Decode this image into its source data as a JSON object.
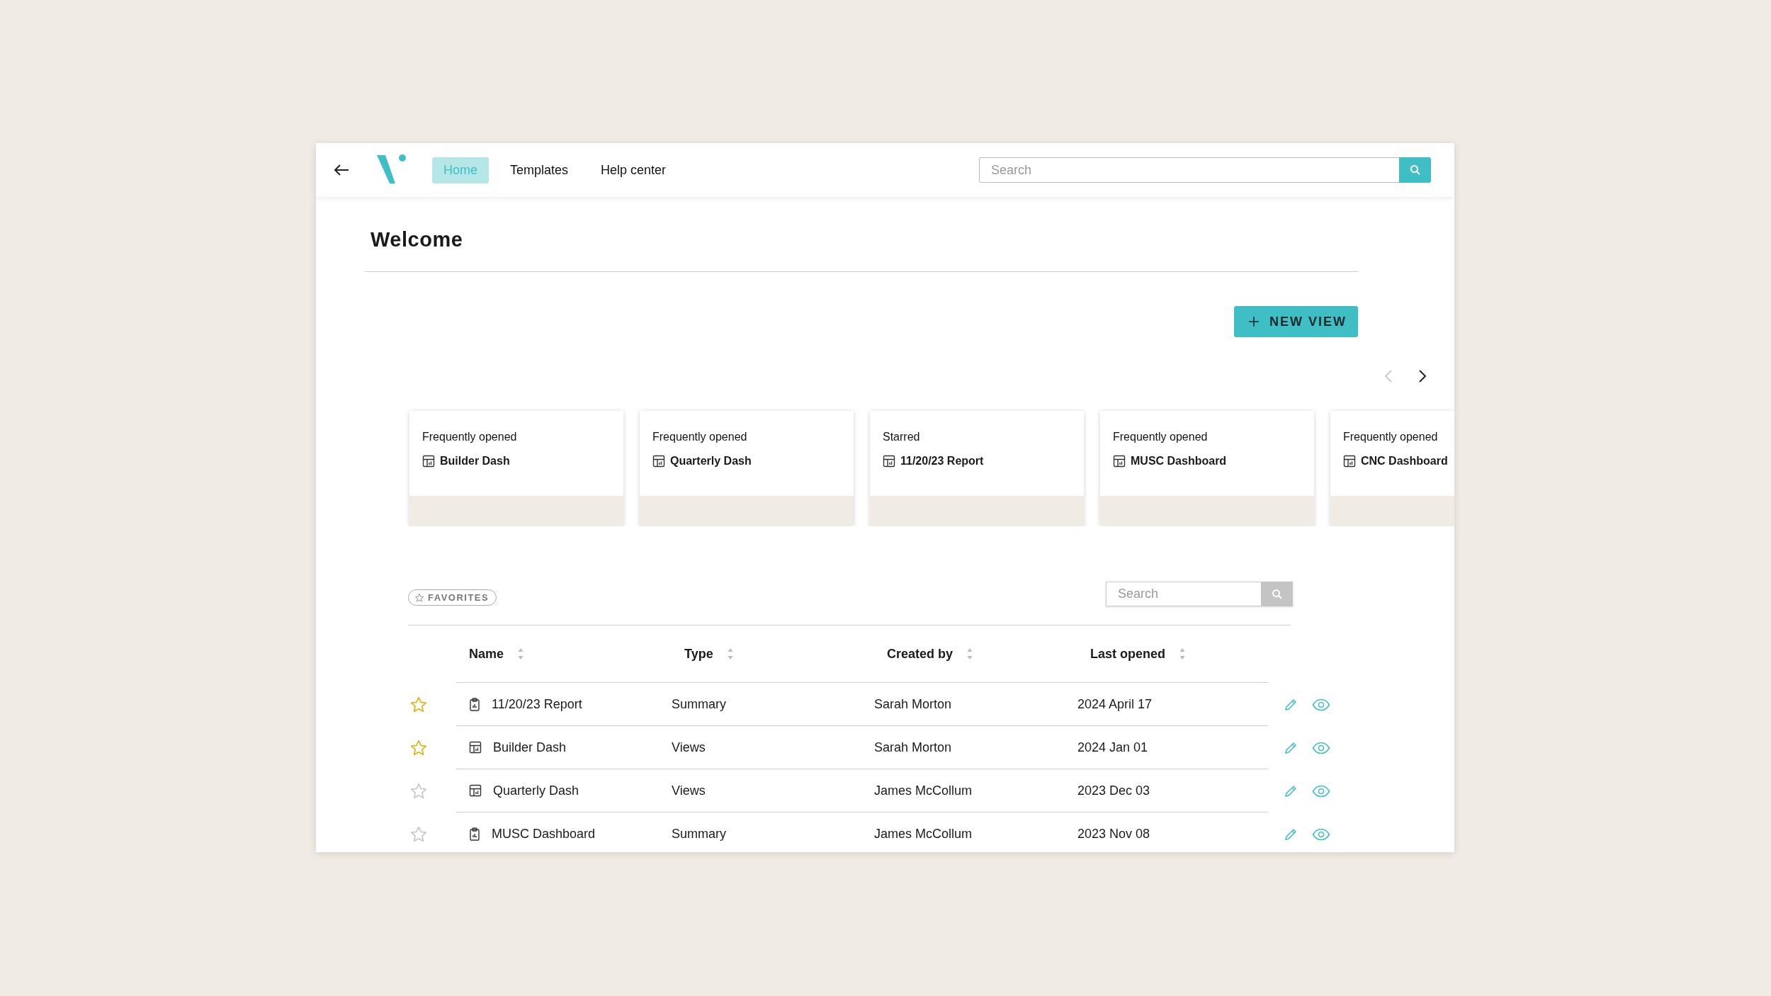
{
  "header": {
    "tabs": [
      {
        "label": "Home",
        "selected": true
      },
      {
        "label": "Templates",
        "selected": false
      },
      {
        "label": "Help center",
        "selected": false
      }
    ],
    "search": {
      "placeholder": "Search"
    }
  },
  "welcome": {
    "title": "Welcome",
    "new_view_button": "NEW VIEW"
  },
  "carousel": {
    "prev_disabled": true,
    "next_disabled": false
  },
  "cards": [
    {
      "caption": "Frequently opened",
      "name": "Builder Dash"
    },
    {
      "caption": "Frequently opened",
      "name": "Quarterly Dash"
    },
    {
      "caption": "Starred",
      "name": "11/20/23 Report"
    },
    {
      "caption": "Frequently opened",
      "name": "MUSC Dashboard"
    },
    {
      "caption": "Frequently opened",
      "name": "CNC Dashboard"
    }
  ],
  "favorites": {
    "filter_label": "FAVORITES",
    "search": {
      "placeholder": "Search"
    }
  },
  "table": {
    "columns": [
      "Name",
      "Type",
      "Created by",
      "Last opened"
    ],
    "rows": [
      {
        "starred": true,
        "kind": "report",
        "name": "11/20/23 Report",
        "type": "Summary",
        "created_by": "Sarah Morton",
        "last_opened": "2024 April 17"
      },
      {
        "starred": true,
        "kind": "dashboard",
        "name": "Builder Dash",
        "type": "Views",
        "created_by": "Sarah Morton",
        "last_opened": "2024 Jan 01"
      },
      {
        "starred": false,
        "kind": "dashboard",
        "name": "Quarterly Dash",
        "type": "Views",
        "created_by": "James McCollum",
        "last_opened": "2023 Dec 03"
      },
      {
        "starred": false,
        "kind": "report",
        "name": "MUSC Dashboard",
        "type": "Summary",
        "created_by": "James McCollum",
        "last_opened": "2023 Nov 08"
      }
    ]
  }
}
